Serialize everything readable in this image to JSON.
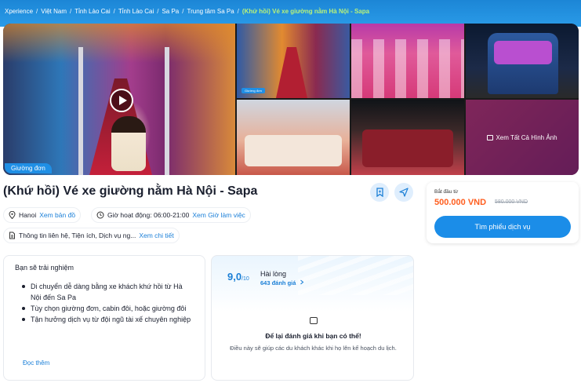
{
  "breadcrumb": {
    "items": [
      "Xperience",
      "Việt Nam",
      "Tỉnh Lào Cai",
      "Tỉnh Lào Cai",
      "Sa Pa",
      "Trung tâm Sa Pa"
    ],
    "current": "(Khứ hồi) Vé xe giường nằm Hà Nội - Sapa",
    "separator": "/"
  },
  "gallery": {
    "main_tag": "Giường đơn",
    "view_all": "Xem Tất Cả Hình Ảnh",
    "thumb_tag": "Giường đơn"
  },
  "product": {
    "title": "(Khứ hồi) Vé xe giường nằm Hà Nội - Sapa",
    "location": "Hanoi",
    "location_link": "Xem bản đồ",
    "hours": "Giờ hoạt động: 06:00-21:00",
    "hours_link": "Xem Giờ làm việc",
    "info": "Thông tin liên hệ, Tiện ích, Dịch vụ ng...",
    "info_link": "Xem chi tiết"
  },
  "pricing": {
    "from_label": "Bắt đầu từ",
    "price": "500.000 VND",
    "old_price": "580.000 VND",
    "cta": "Tìm phiếu dịch vụ"
  },
  "experience": {
    "title": "Bạn sẽ trải nghiệm",
    "items": [
      "Di chuyển dễ dàng bằng xe khách khứ hồi từ Hà Nội đến Sa Pa",
      "Tùy chọn giường đơn, cabin đôi, hoặc giường đôi",
      "Tận hưởng dịch vụ từ đội ngũ tài xế chuyên nghiệp"
    ],
    "read_more": "Đọc thêm"
  },
  "review": {
    "score": "9,0",
    "score_suffix": "/10",
    "label": "Hài lòng",
    "count": "643 đánh giá",
    "prompt_title": "Để lại đánh giá khi bạn có thể!",
    "prompt_body": "Điều này sẽ giúp các du khách khác khi họ lên kế hoạch du lịch."
  },
  "colors": {
    "brand_blue": "#1b8de8",
    "price_orange": "#ff5e1f",
    "breadcrumb_current": "#b8f27a"
  },
  "icons": [
    "play-icon",
    "image-icon",
    "bookmark-icon",
    "share-icon",
    "location-pin-icon",
    "clock-icon",
    "document-icon",
    "chevron-right-icon",
    "chat-icon"
  ]
}
